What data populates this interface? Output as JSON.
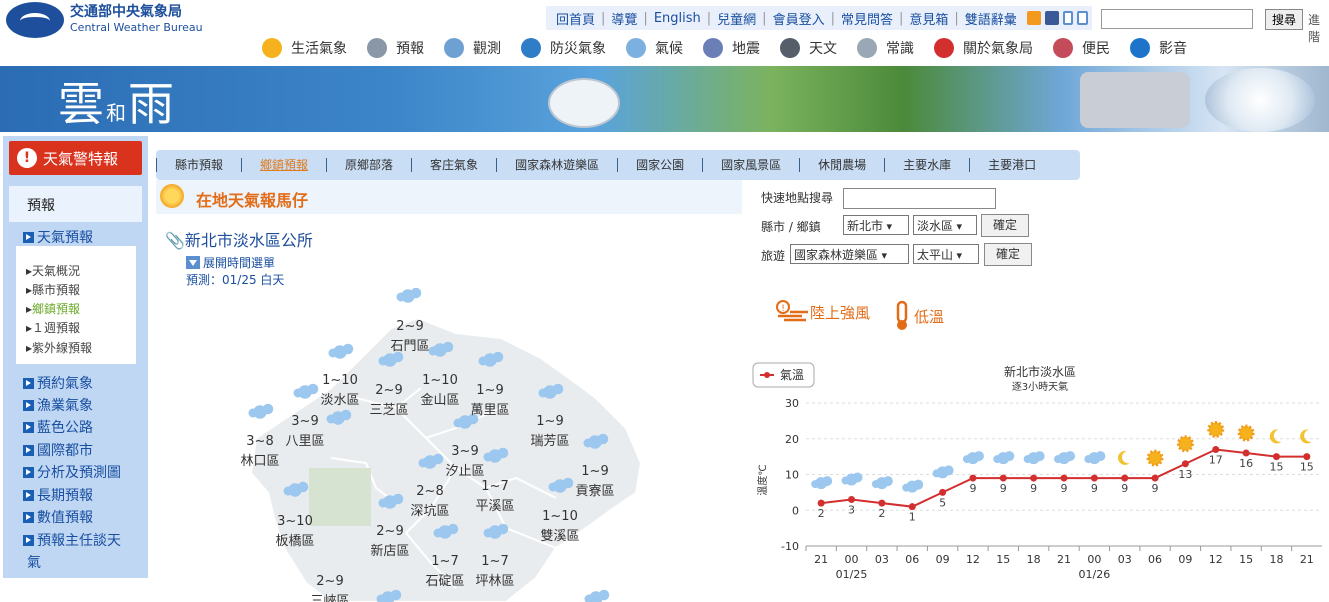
{
  "header": {
    "logo_zh": "交通部中央氣象局",
    "logo_en": "Central Weather Bureau",
    "toplinks": [
      "回首頁",
      "導覽",
      "English",
      "兒童網",
      "會員登入",
      "常見問答",
      "意見箱",
      "雙語辭彙"
    ],
    "search_button": "搜尋",
    "advanced": "進階"
  },
  "banner": {
    "title1": "雲",
    "title2": "和",
    "title3": "雨"
  },
  "mainnav": [
    {
      "label": "生活氣象",
      "icon": "sun-icon",
      "color": "#f5b21c"
    },
    {
      "label": "預報",
      "icon": "megaphone-icon",
      "color": "#8a97a6"
    },
    {
      "label": "觀測",
      "icon": "satellite-dish-icon",
      "color": "#6fa0d4"
    },
    {
      "label": "防災氣象",
      "icon": "typhoon-icon",
      "color": "#2f7cc7"
    },
    {
      "label": "氣候",
      "icon": "cloud-icon",
      "color": "#7bb0e0"
    },
    {
      "label": "地震",
      "icon": "earthquake-icon",
      "color": "#6a7fb5"
    },
    {
      "label": "天文",
      "icon": "telescope-icon",
      "color": "#555e6a"
    },
    {
      "label": "常識",
      "icon": "magnifier-icon",
      "color": "#9aa7b5"
    },
    {
      "label": "關於氣象局",
      "icon": "info-icon",
      "color": "#d32f2f"
    },
    {
      "label": "便民",
      "icon": "people-icon",
      "color": "#c44b5a"
    },
    {
      "label": "影音",
      "icon": "play-icon",
      "color": "#1e74c9"
    }
  ],
  "sidebar": {
    "warning": "天氣警特報",
    "section": "預報",
    "main_items": [
      "天氣預報",
      "預約氣象",
      "漁業氣象",
      "藍色公路",
      "國際都市",
      "分析及預測圖",
      "長期預報",
      "數值預報",
      "預報主任談天",
      "氣"
    ],
    "sub_items": [
      "天氣概況",
      "縣市預報",
      "鄉鎮預報",
      "１週預報",
      "紫外線預報"
    ],
    "active_sub": 2
  },
  "tabs": [
    "縣市預報",
    "鄉鎮預報",
    "原鄉部落",
    "客庄氣象",
    "國家森林遊樂區",
    "國家公園",
    "國家風景區",
    "休閒農場",
    "主要水庫",
    "主要港口"
  ],
  "active_tab": 1,
  "section_title": "在地天氣報馬仔",
  "location_title": "新北市淡水區公所",
  "expand_label": "展開時間選單",
  "forecast_date": "預測：01/25 白天",
  "map_districts": [
    {
      "name": "石門區",
      "temp": "2~9"
    },
    {
      "name": "淡水區",
      "temp": "1~10"
    },
    {
      "name": "三芝區",
      "temp": "2~9"
    },
    {
      "name": "金山區",
      "temp": "1~10"
    },
    {
      "name": "萬里區",
      "temp": "1~9"
    },
    {
      "name": "八里區",
      "temp": "3~9"
    },
    {
      "name": "林口區",
      "temp": "3~8"
    },
    {
      "name": "瑞芳區",
      "temp": "1~9"
    },
    {
      "name": "汐止區",
      "temp": "3~9"
    },
    {
      "name": "貢寮區",
      "temp": "1~9"
    },
    {
      "name": "深坑區",
      "temp": "2~8"
    },
    {
      "name": "平溪區",
      "temp": "1~7"
    },
    {
      "name": "板橋區",
      "temp": "3~10"
    },
    {
      "name": "新店區",
      "temp": "2~9"
    },
    {
      "name": "雙溪區",
      "temp": "1~10"
    },
    {
      "name": "石碇區",
      "temp": "1~7"
    },
    {
      "name": "坪林區",
      "temp": "1~7"
    },
    {
      "name": "三峽區",
      "temp": "2~9"
    }
  ],
  "quick_search": {
    "label": "快速地點搜尋",
    "county_label": "縣市 / 鄉鎮",
    "county": "新北市",
    "town": "淡水區",
    "travel_label": "旅遊",
    "travel_type": "國家森林遊樂區",
    "travel_place": "太平山",
    "confirm": "確定"
  },
  "alerts": [
    {
      "label": "陸上強風",
      "icon": "strong-wind-icon"
    },
    {
      "label": "低溫",
      "icon": "thermometer-icon"
    }
  ],
  "chart_data": {
    "type": "line",
    "title": "新北市淡水區",
    "subtitle": "逐3小時天氣",
    "ylabel": "溫度℃",
    "legend": "氣溫",
    "legend_position": "top-left",
    "ylim": [
      -10,
      30
    ],
    "yticks": [
      30,
      20,
      10,
      0,
      -10
    ],
    "categories": [
      "21",
      "00",
      "03",
      "06",
      "09",
      "12",
      "15",
      "18",
      "21",
      "00",
      "03",
      "06",
      "09",
      "12",
      "15",
      "18",
      "21"
    ],
    "date_labels": [
      {
        "at": 1,
        "label": "01/25"
      },
      {
        "at": 9,
        "label": "01/26"
      }
    ],
    "series": [
      {
        "name": "氣溫",
        "values": [
          2,
          3,
          2,
          1,
          5,
          9,
          9,
          9,
          9,
          9,
          9,
          9,
          13,
          17,
          16,
          15,
          15
        ],
        "color": "#d32f2f"
      }
    ],
    "weather_icons": [
      "cloud",
      "cloud",
      "cloud",
      "cloud",
      "cloud",
      "cloud",
      "cloud",
      "cloud",
      "cloud",
      "cloud",
      "moon",
      "sun",
      "sun",
      "sun",
      "sun",
      "moon",
      "moon"
    ],
    "grid": true
  }
}
